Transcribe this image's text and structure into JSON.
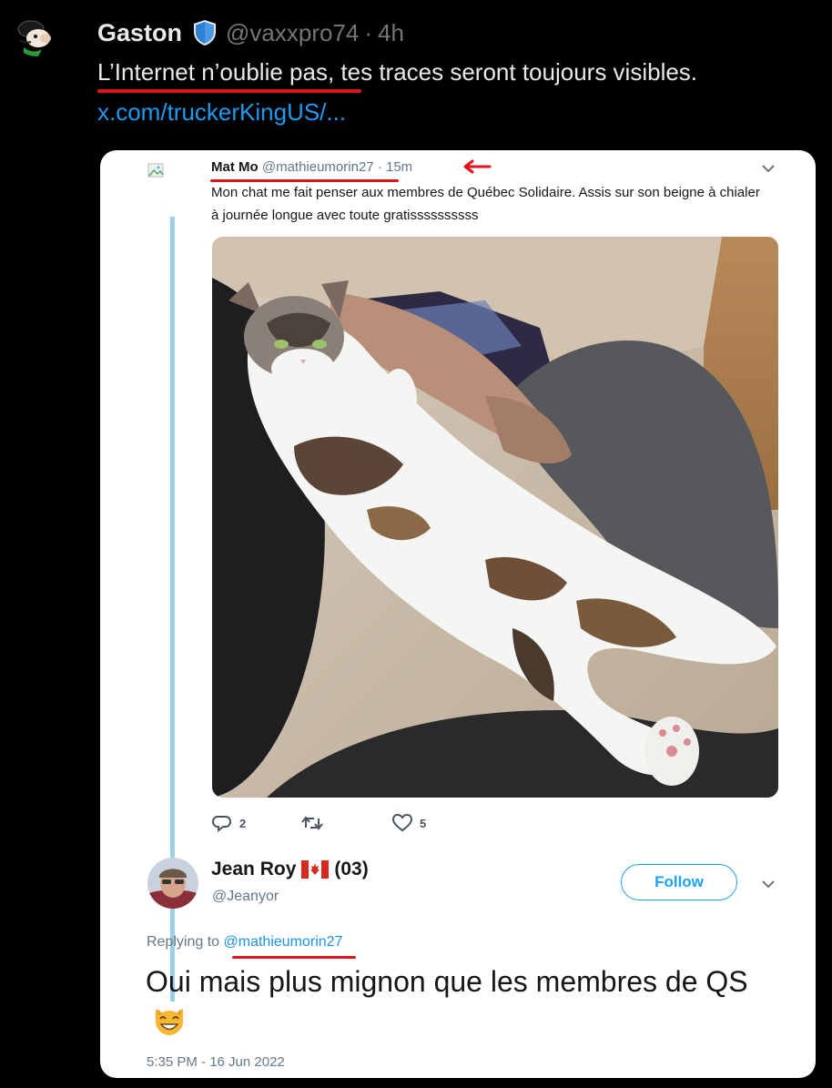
{
  "outer_tweet": {
    "author_name": "Gaston",
    "verified_icon": "shield-badge-icon",
    "handle": "@vaxxpro74",
    "separator": "·",
    "age": "4h",
    "text": "L’Internet n’oublie pas, tes traces seront toujours visibles.",
    "link": "x.com/truckerKingUS/...",
    "annotation_color": "#e1131a"
  },
  "quoted_tweet": {
    "author_name": "Mat Mo",
    "handle": "@mathieumorin27",
    "separator": "·",
    "age": "15m",
    "text": "Mon chat me fait penser aux membres de Québec Solidaire. Assis sur son beigne à chialer à journée longue avec toute gratissssssssss",
    "stats": {
      "replies": "2",
      "likes": "5"
    }
  },
  "reply_tweet": {
    "author_name": "Jean Roy",
    "flag": "🇨🇦",
    "name_suffix": "(03)",
    "handle": "@Jeanyor",
    "follow_label": "Follow",
    "replying_prefix": "Replying to",
    "replying_handle": "@mathieumorin27",
    "text": "Oui mais plus mignon que les membres de QS",
    "emoji": "😸",
    "timestamp": "5:35 PM - 16 Jun 2022"
  },
  "colors": {
    "link_blue": "#1d9bf0",
    "thread_line": "#9cd0e6",
    "follow_blue": "#1da1f2",
    "badge_blue": "#4a99e9"
  }
}
